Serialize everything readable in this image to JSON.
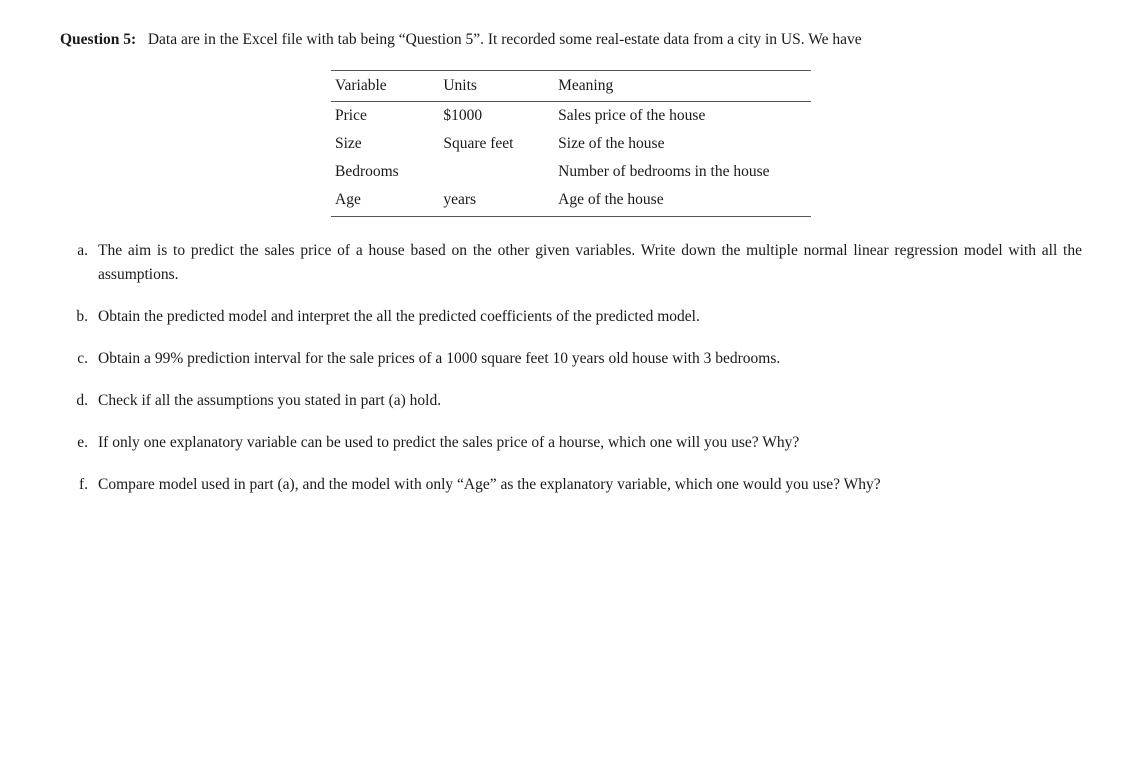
{
  "question": {
    "header": "Question 5:",
    "intro": "Data are in the Excel file with tab being “Question 5”. It recorded some real-estate data from a city in US. We have",
    "table": {
      "columns": [
        "Variable",
        "Units",
        "Meaning"
      ],
      "rows": [
        [
          "Price",
          "$1000",
          "Sales price of the house"
        ],
        [
          "Size",
          "Square feet",
          "Size of the house"
        ],
        [
          "Bedrooms",
          "",
          "Number of bedrooms in the house"
        ],
        [
          "Age",
          "years",
          "Age of the house"
        ]
      ]
    },
    "parts": [
      {
        "label": "a.",
        "text": "The aim is to predict the sales price of a house based on the other given variables. Write down the multiple normal linear regression model with all the assumptions."
      },
      {
        "label": "b.",
        "text": "Obtain the predicted model and interpret the all the predicted coefficients of the predicted model."
      },
      {
        "label": "c.",
        "text": "Obtain a 99% prediction interval for the sale prices of a 1000 square feet 10 years old house with 3 bedrooms."
      },
      {
        "label": "d.",
        "text": "Check if all the assumptions you stated in part (a) hold."
      },
      {
        "label": "e.",
        "text": "If only one explanatory variable can be used to predict the sales price of a hourse, which one will you use? Why?"
      },
      {
        "label": "f.",
        "text": "Compare model used in part (a), and the model with only “Age” as the explanatory variable, which one would you use? Why?"
      }
    ]
  }
}
